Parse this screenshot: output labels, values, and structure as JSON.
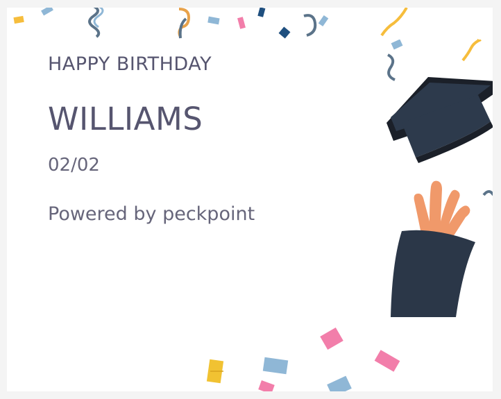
{
  "card": {
    "greeting": "HAPPY BIRTHDAY",
    "name": "WILLIAMS",
    "date": "02/02",
    "powered_by": "Powered by peckpoint"
  },
  "illustration": {
    "icon": "graduation-cap-hand-icon",
    "colors": {
      "cap": "#2d3a4c",
      "cap_dark": "#1b2029",
      "sleeve": "#2b3748",
      "hand": "#f0996a"
    }
  },
  "confetti_colors": [
    "#f6bd3c",
    "#8fb7d6",
    "#f27eaa",
    "#1f4f7f",
    "#5b7389",
    "#e8a24a"
  ]
}
